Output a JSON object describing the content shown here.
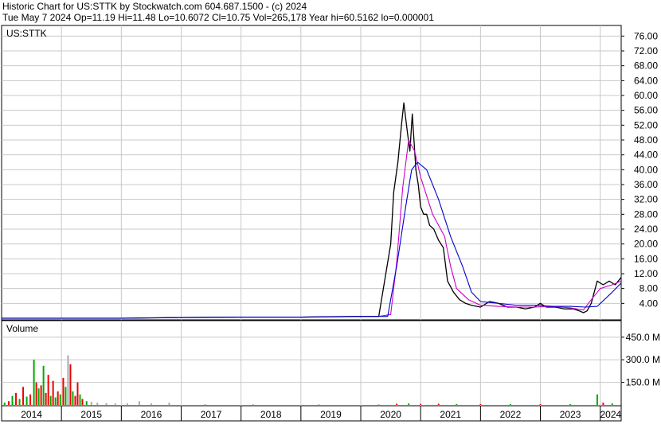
{
  "header": {
    "title": "Historic Chart for US:STTK by Stockwatch.com 604.687.1500 - (c) 2024",
    "quote": "Tue May  7 2024   Op=11.19   Hi=11.48   Lo=10.6072   Cl=10.75   Vol=265,178   Year hi=60.5162   lo=0.000001"
  },
  "chart_data": [
    {
      "type": "line",
      "symbol_label": "US:STTK",
      "y_ticks": [
        "76.00",
        "72.00",
        "68.00",
        "64.00",
        "60.00",
        "56.00",
        "52.00",
        "48.00",
        "44.00",
        "40.00",
        "36.00",
        "32.00",
        "28.00",
        "24.00",
        "20.00",
        "16.00",
        "12.00",
        "8.00",
        "4.00"
      ],
      "ylim": [
        0,
        78
      ],
      "x_labels": [
        "2014",
        "2015",
        "2016",
        "2017",
        "2018",
        "2019",
        "2020",
        "2021",
        "2022",
        "2023",
        "2024"
      ],
      "series": [
        {
          "name": "",
          "color": "#000000",
          "x": [
            2014.0,
            2015.0,
            2016.0,
            2017.0,
            2018.0,
            2019.0,
            2020.0,
            2020.3,
            2020.5,
            2020.55,
            2020.62,
            2020.68,
            2020.72,
            2020.78,
            2020.82,
            2020.86,
            2020.92,
            2020.96,
            2021.0,
            2021.05,
            2021.1,
            2021.15,
            2021.22,
            2021.3,
            2021.38,
            2021.45,
            2021.55,
            2021.65,
            2021.75,
            2021.85,
            2022.0,
            2022.15,
            2022.3,
            2022.45,
            2022.6,
            2022.75,
            2022.9,
            2023.0,
            2023.1,
            2023.25,
            2023.4,
            2023.55,
            2023.65,
            2023.72,
            2023.78,
            2023.85,
            2023.95,
            2024.05,
            2024.15,
            2024.25,
            2024.35
          ],
          "values": [
            0,
            0,
            0,
            0.2,
            0.3,
            0.3,
            0.5,
            0.5,
            20,
            34,
            42,
            52,
            58,
            50,
            45,
            55,
            40,
            36,
            30,
            28,
            28,
            25,
            24,
            21,
            19,
            10,
            7,
            5,
            4,
            3.5,
            3,
            4.5,
            4,
            3,
            3,
            2.5,
            3,
            4,
            3,
            3,
            2.5,
            2.5,
            2,
            1.5,
            2,
            4,
            10,
            9,
            10,
            9,
            11
          ]
        },
        {
          "name": "",
          "color": "#cc00cc",
          "x": [
            2020.3,
            2020.5,
            2020.6,
            2020.7,
            2020.8,
            2020.9,
            2021.0,
            2021.2,
            2021.4,
            2021.5,
            2021.6,
            2021.8,
            2022.0,
            2022.3,
            2022.6,
            2022.9,
            2023.2,
            2023.5,
            2023.72,
            2023.85,
            2024.0,
            2024.2,
            2024.35
          ],
          "values": [
            0.5,
            1,
            15,
            35,
            48,
            45,
            38,
            28,
            22,
            14,
            8,
            5,
            3.5,
            3.2,
            3,
            3,
            3.2,
            2.8,
            2.2,
            5,
            8,
            9,
            10
          ]
        },
        {
          "name": "",
          "color": "#0000cc",
          "x": [
            2014.0,
            2015.0,
            2016.0,
            2017.0,
            2018.0,
            2019.0,
            2020.0,
            2020.45,
            2020.6,
            2020.75,
            2020.85,
            2020.95,
            2021.1,
            2021.3,
            2021.5,
            2021.7,
            2021.85,
            2022.0,
            2022.3,
            2022.6,
            2022.9,
            2023.2,
            2023.5,
            2023.75,
            2023.95,
            2024.2,
            2024.35
          ],
          "values": [
            0,
            0,
            0,
            0.2,
            0.3,
            0.3,
            0.5,
            0.5,
            14,
            30,
            40,
            42,
            40,
            32,
            22,
            14,
            7,
            4.5,
            4,
            3.5,
            3.5,
            3.2,
            3.2,
            3,
            3.2,
            7,
            9.5
          ]
        }
      ]
    },
    {
      "type": "bar",
      "title": "Volume",
      "y_ticks": [
        "450.0 M",
        "300.0 M",
        "150.0 M"
      ],
      "ylim": [
        0,
        560
      ],
      "bars": [
        {
          "x": 2014.05,
          "v": 15,
          "color": "#00aa00"
        },
        {
          "x": 2014.12,
          "v": 25,
          "color": "#ee0000"
        },
        {
          "x": 2014.18,
          "v": 60,
          "color": "#00aa00"
        },
        {
          "x": 2014.24,
          "v": 80,
          "color": "#ee0000"
        },
        {
          "x": 2014.3,
          "v": 40,
          "color": "#00aa00"
        },
        {
          "x": 2014.36,
          "v": 120,
          "color": "#ee0000"
        },
        {
          "x": 2014.42,
          "v": 55,
          "color": "#00aa00"
        },
        {
          "x": 2014.48,
          "v": 70,
          "color": "#ee0000"
        },
        {
          "x": 2014.54,
          "v": 300,
          "color": "#00aa00"
        },
        {
          "x": 2014.58,
          "v": 150,
          "color": "#ee0000"
        },
        {
          "x": 2014.62,
          "v": 110,
          "color": "#00aa00"
        },
        {
          "x": 2014.66,
          "v": 130,
          "color": "#ee0000"
        },
        {
          "x": 2014.7,
          "v": 260,
          "color": "#00aa00"
        },
        {
          "x": 2014.74,
          "v": 80,
          "color": "#ee0000"
        },
        {
          "x": 2014.78,
          "v": 200,
          "color": "#ee0000"
        },
        {
          "x": 2014.82,
          "v": 60,
          "color": "#00aa00"
        },
        {
          "x": 2014.86,
          "v": 160,
          "color": "#ee0000"
        },
        {
          "x": 2014.9,
          "v": 50,
          "color": "#00aa00"
        },
        {
          "x": 2014.94,
          "v": 90,
          "color": "#ee0000"
        },
        {
          "x": 2014.98,
          "v": 70,
          "color": "#00aa00"
        },
        {
          "x": 2015.03,
          "v": 180,
          "color": "#ee0000"
        },
        {
          "x": 2015.07,
          "v": 120,
          "color": "#00aa00"
        },
        {
          "x": 2015.11,
          "v": 330,
          "color": "#aaaaaa"
        },
        {
          "x": 2015.15,
          "v": 270,
          "color": "#ee0000"
        },
        {
          "x": 2015.19,
          "v": 90,
          "color": "#00aa00"
        },
        {
          "x": 2015.23,
          "v": 60,
          "color": "#ee0000"
        },
        {
          "x": 2015.27,
          "v": 150,
          "color": "#ee0000"
        },
        {
          "x": 2015.31,
          "v": 70,
          "color": "#00aa00"
        },
        {
          "x": 2015.35,
          "v": 40,
          "color": "#ee0000"
        },
        {
          "x": 2015.42,
          "v": 25,
          "color": "#00aa00"
        },
        {
          "x": 2015.5,
          "v": 20,
          "color": "#aaaaaa"
        },
        {
          "x": 2015.6,
          "v": 15,
          "color": "#aaaaaa"
        },
        {
          "x": 2015.75,
          "v": 12,
          "color": "#aaaaaa"
        },
        {
          "x": 2015.9,
          "v": 10,
          "color": "#aaaaaa"
        },
        {
          "x": 2016.1,
          "v": 12,
          "color": "#aaaaaa"
        },
        {
          "x": 2016.3,
          "v": 25,
          "color": "#aaaaaa"
        },
        {
          "x": 2016.5,
          "v": 10,
          "color": "#aaaaaa"
        },
        {
          "x": 2016.8,
          "v": 15,
          "color": "#aaaaaa"
        },
        {
          "x": 2017.4,
          "v": 6,
          "color": "#aaaaaa"
        },
        {
          "x": 2018.2,
          "v": 5,
          "color": "#aaaaaa"
        },
        {
          "x": 2019.3,
          "v": 5,
          "color": "#aaaaaa"
        },
        {
          "x": 2020.3,
          "v": 5,
          "color": "#aaaaaa"
        },
        {
          "x": 2020.6,
          "v": 8,
          "color": "#ee0000"
        },
        {
          "x": 2020.8,
          "v": 10,
          "color": "#00aa00"
        },
        {
          "x": 2021.0,
          "v": 7,
          "color": "#ee0000"
        },
        {
          "x": 2021.3,
          "v": 8,
          "color": "#ee0000"
        },
        {
          "x": 2021.6,
          "v": 6,
          "color": "#00aa00"
        },
        {
          "x": 2022.0,
          "v": 6,
          "color": "#ee0000"
        },
        {
          "x": 2022.5,
          "v": 5,
          "color": "#00aa00"
        },
        {
          "x": 2023.0,
          "v": 5,
          "color": "#ee0000"
        },
        {
          "x": 2023.5,
          "v": 5,
          "color": "#00aa00"
        },
        {
          "x": 2023.95,
          "v": 70,
          "color": "#00aa00"
        },
        {
          "x": 2024.05,
          "v": 15,
          "color": "#ee0000"
        },
        {
          "x": 2024.2,
          "v": 10,
          "color": "#00aa00"
        }
      ]
    }
  ]
}
